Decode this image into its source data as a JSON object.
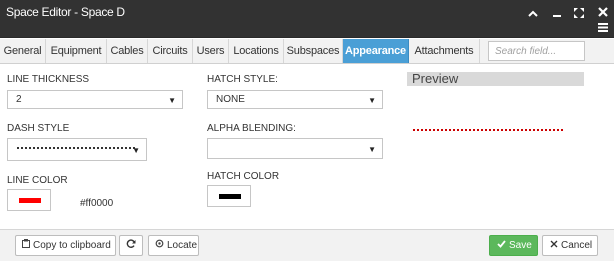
{
  "window": {
    "title": "Space Editor - Space D",
    "controls": [
      "chevron-up-icon",
      "minus-icon",
      "expand-icon",
      "close-icon",
      "menu-icon"
    ]
  },
  "tabs": [
    {
      "label": "General"
    },
    {
      "label": "Equipment"
    },
    {
      "label": "Cables"
    },
    {
      "label": "Circuits"
    },
    {
      "label": "Users"
    },
    {
      "label": "Locations"
    },
    {
      "label": "Subspaces"
    },
    {
      "label": "Appearance",
      "active": true
    },
    {
      "label": "Attachments"
    }
  ],
  "search": {
    "placeholder": "Search field..."
  },
  "form": {
    "line_thickness": {
      "label": "LINE THICKNESS",
      "value": "2"
    },
    "dash_style": {
      "label": "DASH STYLE"
    },
    "line_color": {
      "label": "LINE COLOR",
      "hex": "#ff0000",
      "swatch": "#ff0000"
    },
    "hatch_style": {
      "label": "HATCH STYLE:",
      "value": "NONE"
    },
    "alpha_blending": {
      "label": "ALPHA BLENDING:",
      "value": ""
    },
    "hatch_color": {
      "label": "HATCH COLOR",
      "swatch": "#000000"
    }
  },
  "preview": {
    "title": "Preview",
    "line_color": "#cc0000"
  },
  "footer": {
    "copy_label": "Copy to clipboard",
    "locate_label": "Locate",
    "save_label": "Save",
    "cancel_label": "Cancel"
  },
  "colors": {
    "titlebar": "#323232",
    "active_tab": "#4a9fd6",
    "save": "#5cb85c"
  }
}
